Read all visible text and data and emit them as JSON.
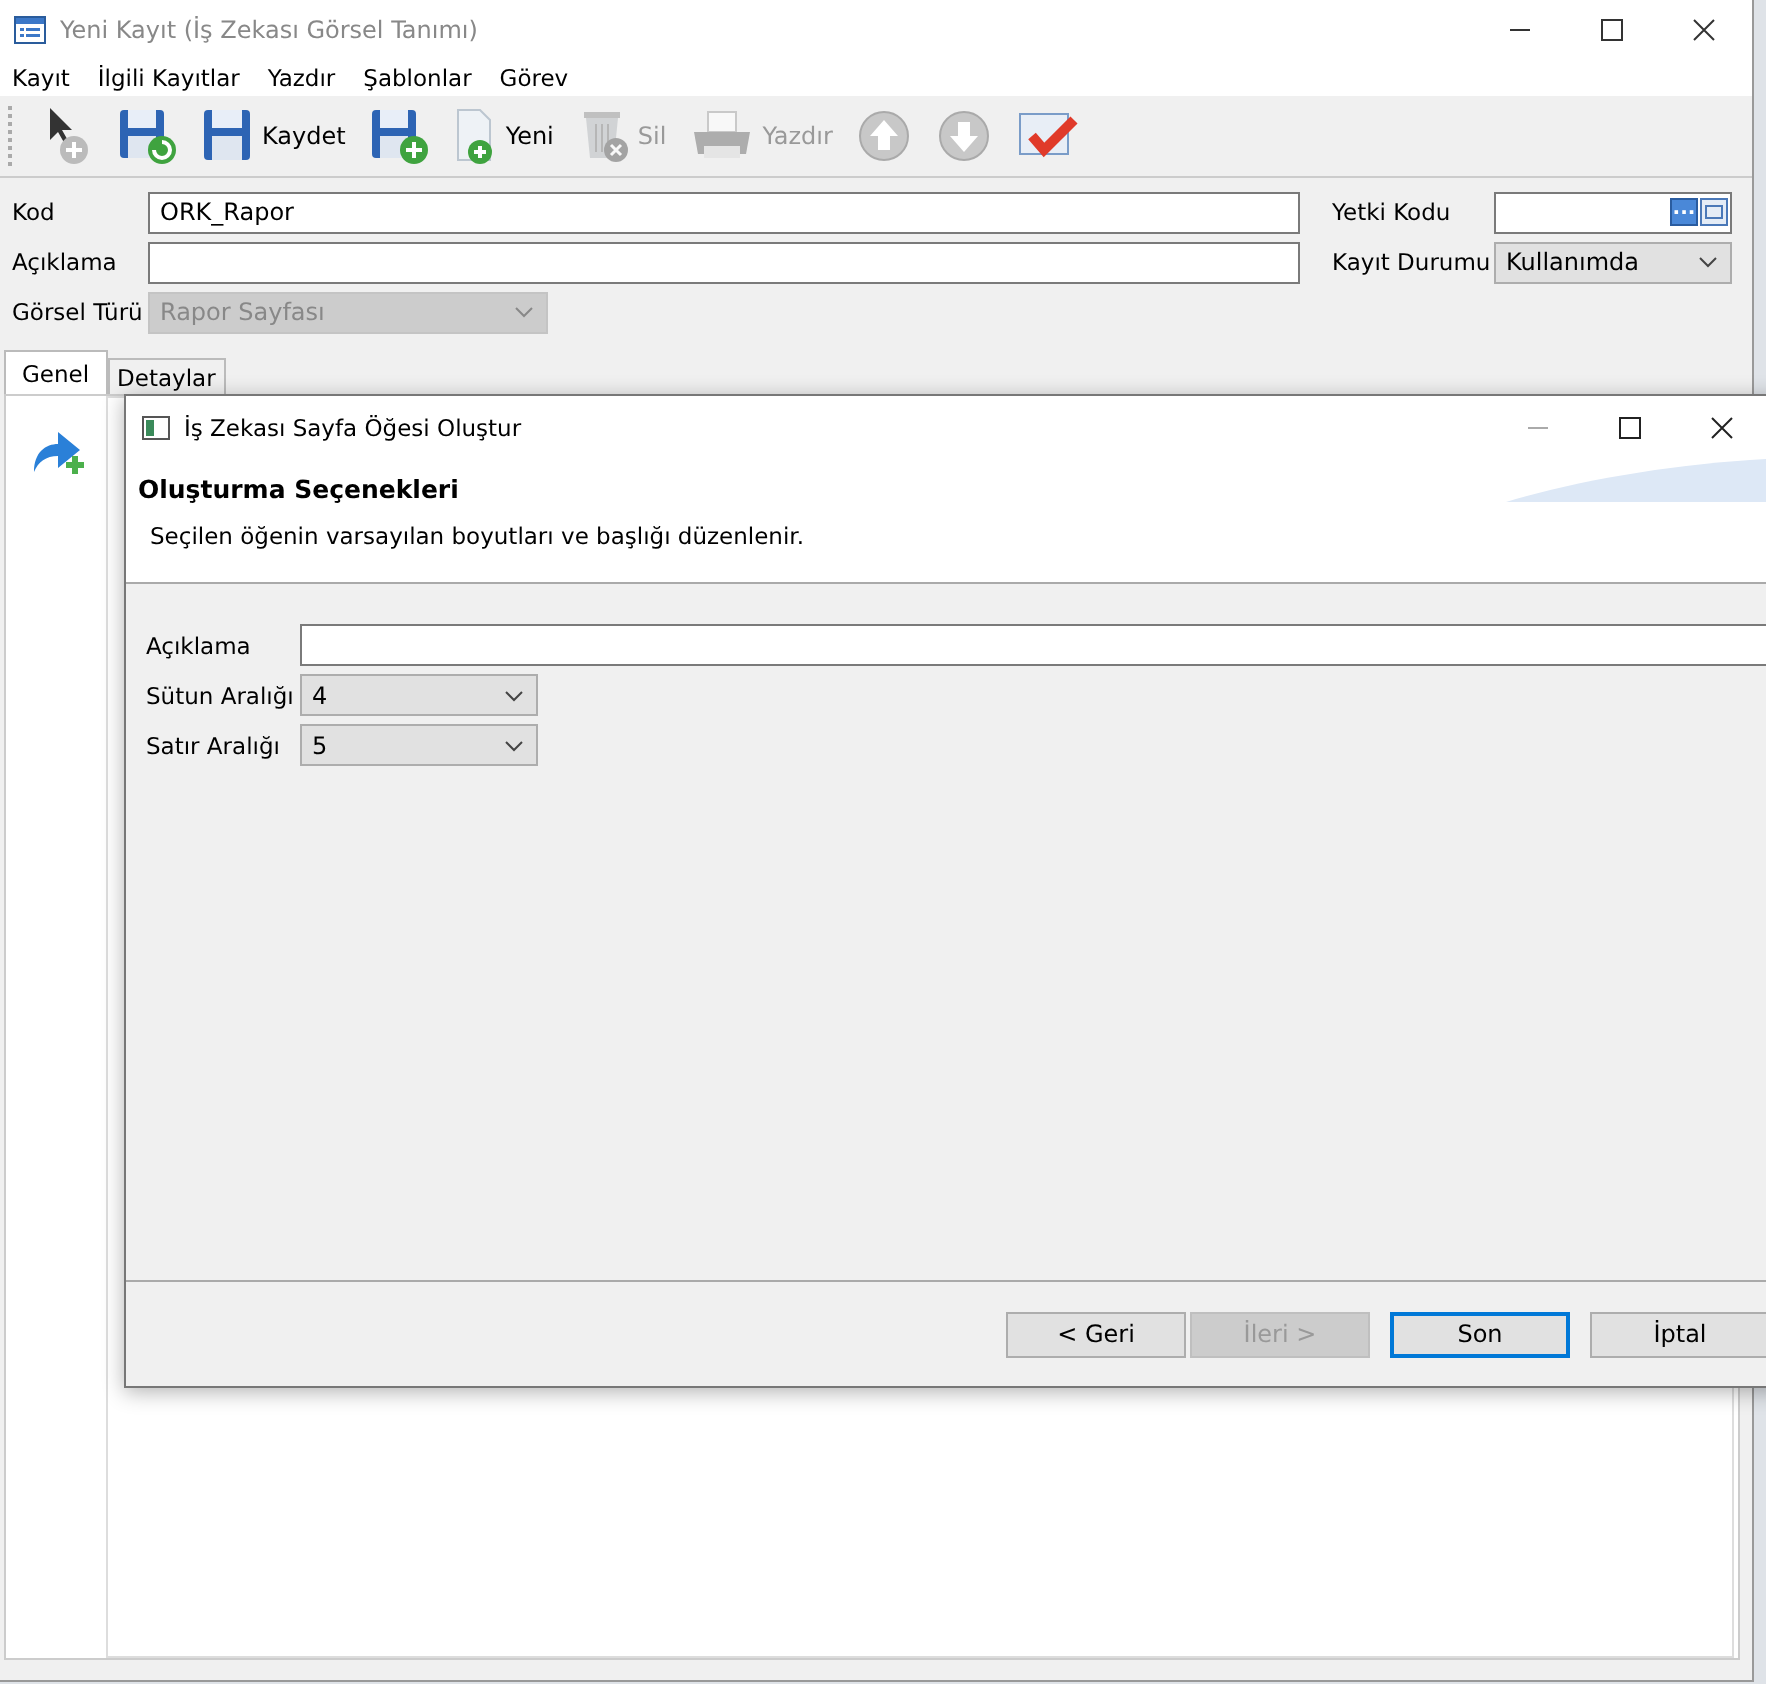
{
  "window": {
    "title": "Yeni Kayıt (İş Zekası Görsel Tanımı)"
  },
  "menu": [
    "Kayıt",
    "İlgili Kayıtlar",
    "Yazdır",
    "Şablonlar",
    "Görev"
  ],
  "toolbar": [
    {
      "kind": "pointer",
      "disabled": false
    },
    {
      "kind": "saverefresh",
      "disabled": false
    },
    {
      "kind": "save",
      "label": "Kaydet",
      "disabled": false
    },
    {
      "kind": "saveadd",
      "disabled": false
    },
    {
      "kind": "newdoc",
      "label": "Yeni",
      "disabled": false
    },
    {
      "kind": "trash",
      "label": "Sil",
      "disabled": true
    },
    {
      "kind": "printer",
      "label": "Yazdır",
      "disabled": true
    },
    {
      "kind": "up",
      "disabled": false
    },
    {
      "kind": "down",
      "disabled": false
    },
    {
      "kind": "check",
      "disabled": false
    }
  ],
  "form": {
    "kod": {
      "label": "Kod",
      "value": "ORK_Rapor"
    },
    "aciklama": {
      "label": "Açıklama"
    },
    "gorsel_turu": {
      "label": "Görsel Türü",
      "value": "Rapor Sayfası",
      "disabled": true
    },
    "yetki_kodu": {
      "label": "Yetki Kodu",
      "button": "..."
    },
    "kayit_durumu": {
      "label": "Kayıt Durumu",
      "value": "Kullanımda"
    }
  },
  "tabs": [
    {
      "label": "Genel",
      "selected": true
    },
    {
      "label": "Detaylar",
      "selected": false
    }
  ],
  "dialog": {
    "title": "İş Zekası Sayfa Öğesi Oluştur",
    "heading": "Oluşturma Seçenekleri",
    "description": "Seçilen öğenin varsayılan boyutları ve başlığı düzenlenir.",
    "fields": [
      {
        "kind": "text",
        "label": "Açıklama"
      },
      {
        "kind": "select",
        "label": "Sütun Aralığı",
        "value": "4"
      },
      {
        "kind": "select",
        "label": "Satır Aralığı",
        "value": "5"
      }
    ],
    "buttons": [
      {
        "label": "< Geri",
        "disabled": false,
        "default": false
      },
      {
        "label": "İleri >",
        "disabled": true,
        "default": false
      },
      {
        "label": "Son",
        "disabled": false,
        "default": true
      },
      {
        "label": "İptal",
        "disabled": false,
        "default": false
      }
    ]
  }
}
